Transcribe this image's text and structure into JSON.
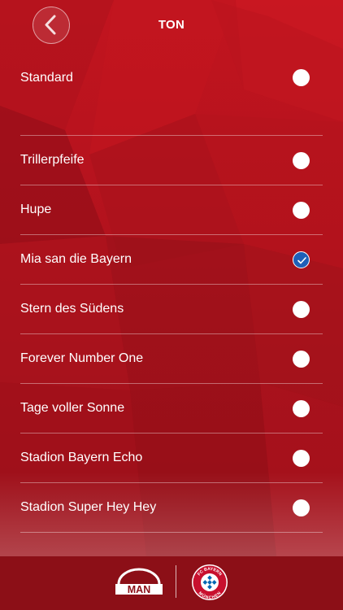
{
  "header": {
    "title": "TON",
    "back_icon": "chevron-left-icon"
  },
  "options": [
    {
      "label": "Standard",
      "selected": false
    },
    {
      "label": "Trillerpfeife",
      "selected": false
    },
    {
      "label": "Hupe",
      "selected": false
    },
    {
      "label": "Mia san die Bayern",
      "selected": true
    },
    {
      "label": "Stern des Südens",
      "selected": false
    },
    {
      "label": "Forever Number One",
      "selected": false
    },
    {
      "label": "Tage voller Sonne",
      "selected": false
    },
    {
      "label": "Stadion Bayern Echo",
      "selected": false
    },
    {
      "label": "Stadion Super Hey Hey",
      "selected": false
    }
  ],
  "footer": {
    "man_logo_text": "MAN",
    "fcb_logo_text_top": "FC BAYERN",
    "fcb_logo_text_bottom": "MÜNCHEN"
  },
  "colors": {
    "background": "#a3111c",
    "footer": "#8c0f17",
    "selected_radio": "#1e5fb8"
  }
}
